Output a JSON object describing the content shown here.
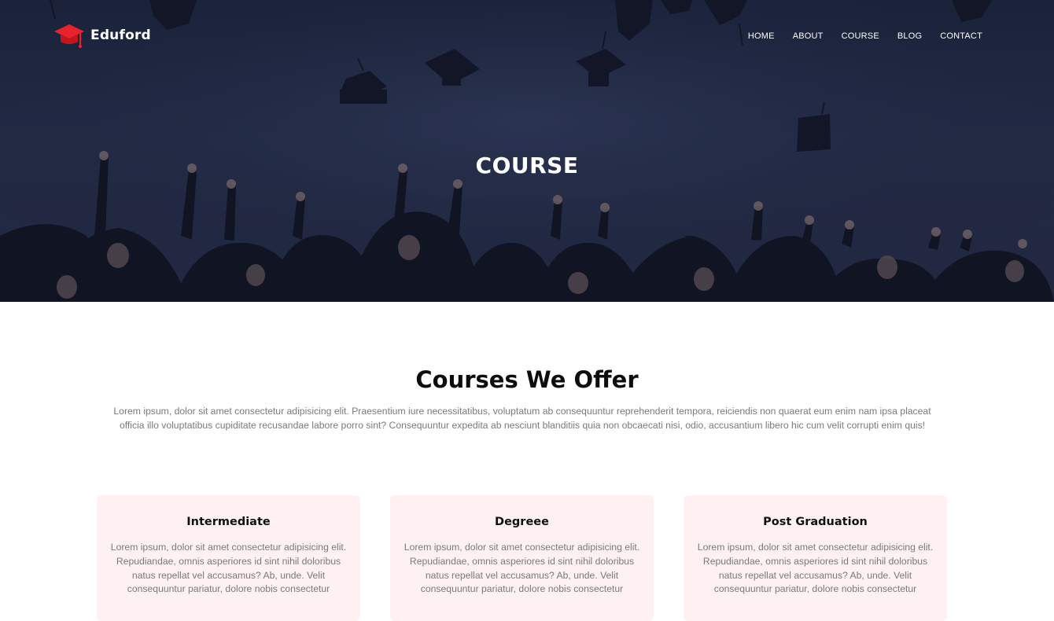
{
  "brand": {
    "name": "Eduford",
    "accent_color": "#e8232b",
    "logo_icon": "graduation-cap-icon"
  },
  "nav": {
    "items": [
      "HOME",
      "ABOUT",
      "COURSE",
      "BLOG",
      "CONTACT"
    ]
  },
  "hero": {
    "title": "COURSE",
    "background_icon": "graduates-throwing-caps-photo"
  },
  "courses_section": {
    "title": "Courses We Offer",
    "description": "Lorem ipsum, dolor sit amet consectetur adipisicing elit. Praesentium iure necessitatibus, voluptatum ab consequuntur reprehenderit tempora, reiciendis non quaerat eum enim nam ipsa placeat officia illo voluptatibus cupiditate recusandae labore porro sint? Consequuntur expedita ab nesciunt blanditiis quia non obcaecati nisi, odio, accusantium libero hic cum velit corrupti enim quis!",
    "card_color": "#fff1f1",
    "cards": [
      {
        "title": "Intermediate",
        "text": "Lorem ipsum, dolor sit amet consectetur adipisicing elit. Repudiandae, omnis asperiores id sint nihil doloribus natus repellat vel accusamus? Ab, unde. Velit consequuntur pariatur, dolore nobis consectetur"
      },
      {
        "title": "Degreee",
        "text": "Lorem ipsum, dolor sit amet consectetur adipisicing elit. Repudiandae, omnis asperiores id sint nihil doloribus natus repellat vel accusamus? Ab, unde. Velit consequuntur pariatur, dolore nobis consectetur"
      },
      {
        "title": "Post Graduation",
        "text": "Lorem ipsum, dolor sit amet consectetur adipisicing elit. Repudiandae, omnis asperiores id sint nihil doloribus natus repellat vel accusamus? Ab, unde. Velit consequuntur pariatur, dolore nobis consectetur"
      }
    ]
  }
}
